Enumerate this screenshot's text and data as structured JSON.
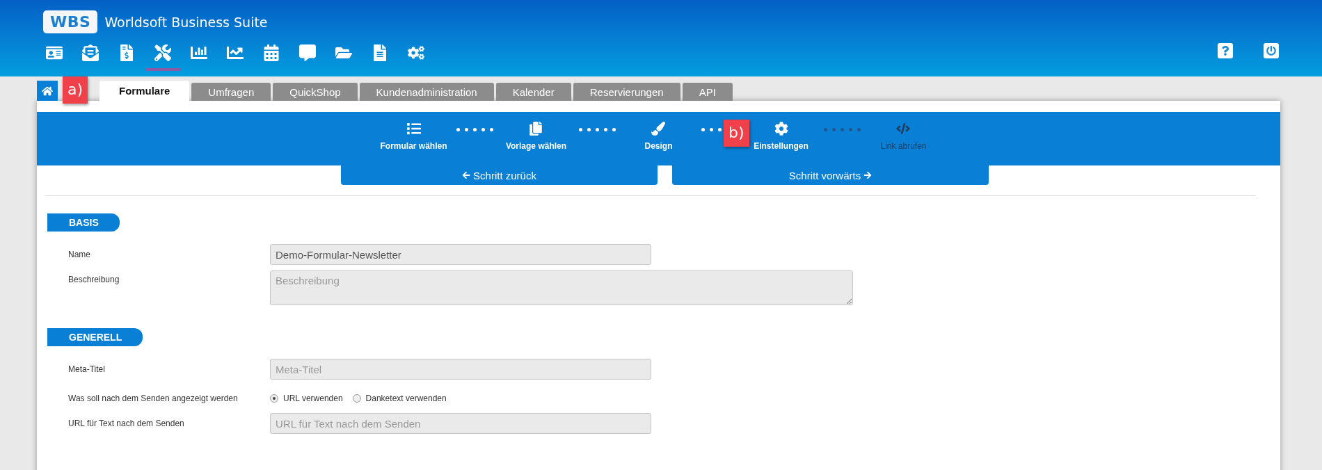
{
  "header": {
    "logo": "WBS",
    "title": "Worldsoft Business Suite"
  },
  "nav_icons": [
    {
      "kind": "contacts",
      "selected": false
    },
    {
      "kind": "mail",
      "selected": false
    },
    {
      "kind": "invoice",
      "selected": false
    },
    {
      "kind": "tools",
      "selected": true
    },
    {
      "kind": "chart",
      "selected": false
    },
    {
      "kind": "stats",
      "selected": false
    },
    {
      "kind": "calendar",
      "selected": false
    },
    {
      "kind": "message",
      "selected": false
    },
    {
      "kind": "folder",
      "selected": false
    },
    {
      "kind": "document",
      "selected": false
    },
    {
      "kind": "gears",
      "selected": false
    }
  ],
  "header_actions": [
    {
      "kind": "help"
    },
    {
      "kind": "power"
    }
  ],
  "tabs": [
    {
      "label": "Formulare",
      "selected": true
    },
    {
      "label": "Umfragen",
      "selected": false
    },
    {
      "label": "QuickShop",
      "selected": false
    },
    {
      "label": "Kundenadministration",
      "selected": false
    },
    {
      "label": "Kalender",
      "selected": false
    },
    {
      "label": "Reservierungen",
      "selected": false
    },
    {
      "label": "API",
      "selected": false
    }
  ],
  "steps": [
    {
      "kind": "list",
      "label": "Formular wählen",
      "reached": true
    },
    {
      "kind": "copy",
      "label": "Vorlage wählen",
      "reached": true
    },
    {
      "kind": "brush",
      "label": "Design",
      "reached": true
    },
    {
      "kind": "gear",
      "label": "Einstellungen",
      "reached": true
    },
    {
      "kind": "code",
      "label": "Link abrufen",
      "reached": false
    }
  ],
  "step_buttons": [
    {
      "kind": "back",
      "label": "Schritt zurück"
    },
    {
      "kind": "forward",
      "label": "Schritt vorwärts"
    }
  ],
  "sections": [
    {
      "title": "BASIS",
      "fields": [
        {
          "kind": "input",
          "label": "Name",
          "value": "Demo-Formular-Newsletter"
        },
        {
          "kind": "textarea",
          "label": "Beschreibung",
          "placeholder": "Beschreibung"
        }
      ]
    },
    {
      "title": "GENERELL",
      "fields": [
        {
          "kind": "input",
          "label": "Meta-Titel",
          "placeholder": "Meta-Titel"
        },
        {
          "kind": "radio",
          "label": "Was soll nach dem Senden angezeigt werden",
          "options": [
            {
              "label": "URL verwenden",
              "selected": true
            },
            {
              "label": "Danketext verwenden",
              "selected": false
            }
          ]
        },
        {
          "kind": "input",
          "label": "URL für Text nach dem Senden",
          "placeholder": "URL für Text nach dem Senden"
        }
      ]
    }
  ],
  "annotations": [
    {
      "label": "a)"
    },
    {
      "label": "b)"
    }
  ]
}
